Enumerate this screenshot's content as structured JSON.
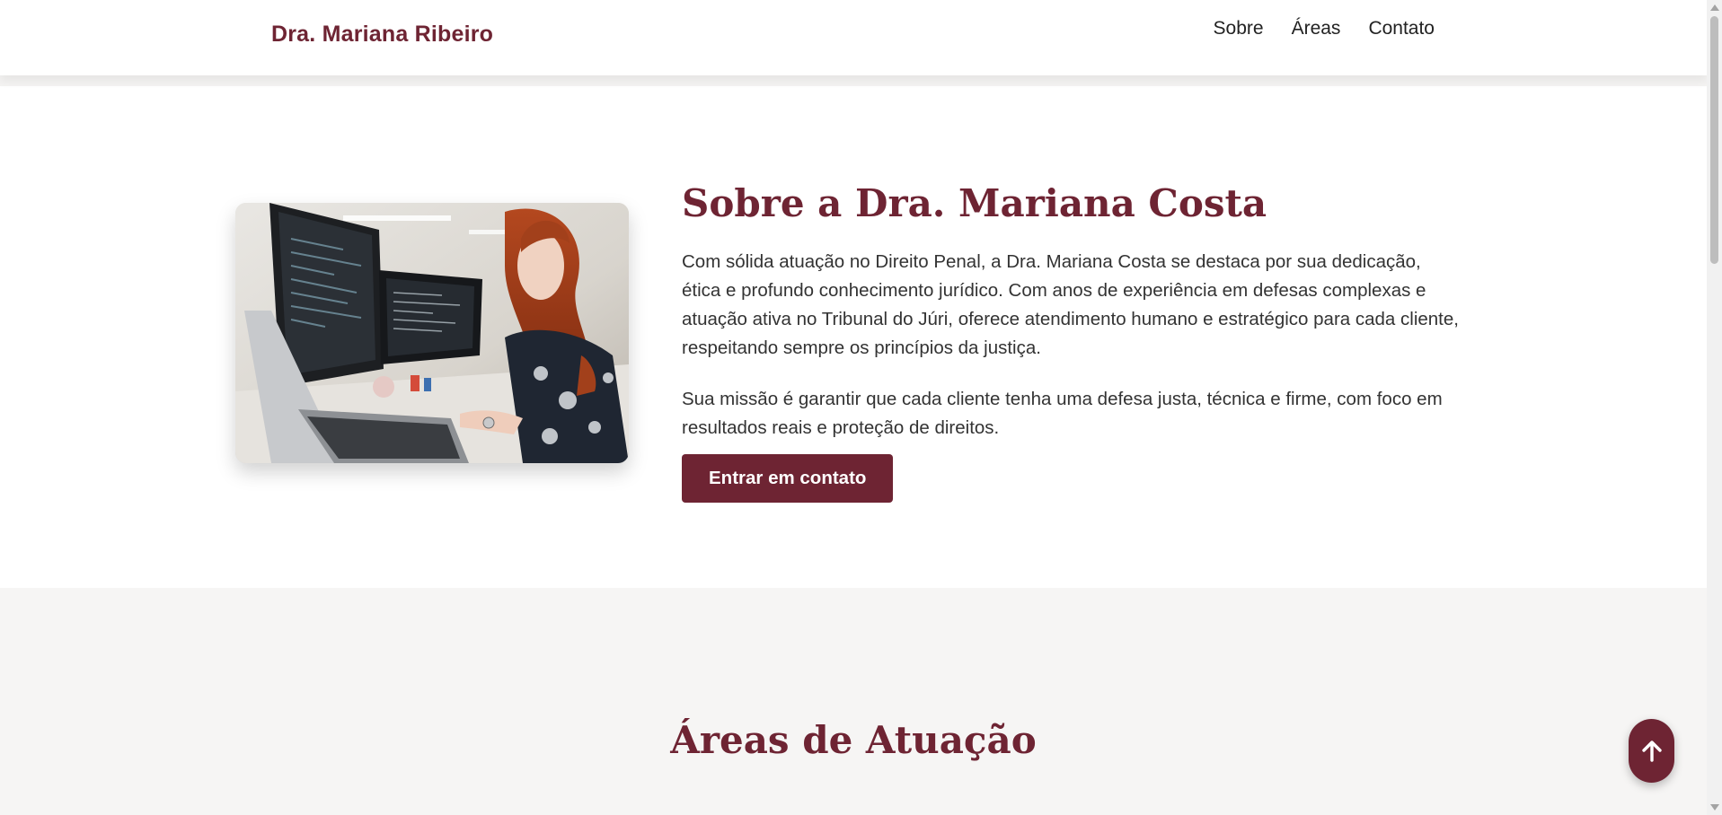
{
  "header": {
    "brand": "Dra. Mariana Ribeiro",
    "nav": [
      "Sobre",
      "Áreas",
      "Contato"
    ]
  },
  "about": {
    "title": "Sobre a Dra. Mariana Costa",
    "paragraphs": [
      "Com sólida atuação no Direito Penal, a Dra. Mariana Costa se destaca por sua dedicação, ética e profundo conhecimento jurídico. Com anos de experiência em defesas complexas e atuação ativa no Tribunal do Júri, oferece atendimento humano e estratégico para cada cliente, respeitando sempre os princípios da justiça.",
      "Sua missão é garantir que cada cliente tenha uma defesa justa, técnica e firme, com foco em resultados reais e proteção de direitos."
    ],
    "cta_label": "Entrar em contato"
  },
  "areas": {
    "title": "Áreas de Atuação"
  },
  "icons": {
    "back_to_top": "arrow-up-icon"
  },
  "colors": {
    "brand": "#6e2433",
    "text": "#333333",
    "section_bg": "#f6f5f4"
  }
}
